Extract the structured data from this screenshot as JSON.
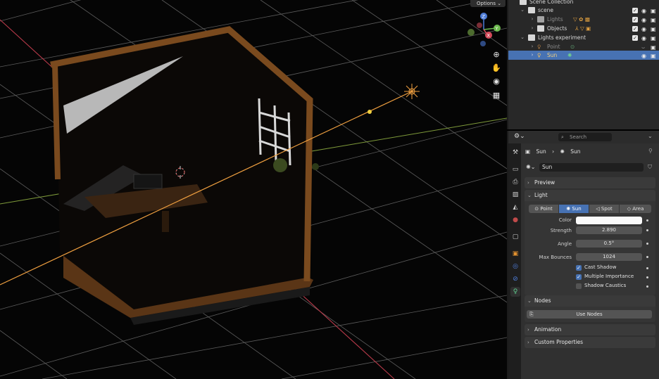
{
  "viewport": {
    "options_label": "Options",
    "gizmo": {
      "z": "Z",
      "y": "Y",
      "x": "X"
    },
    "tools": [
      "zoom-icon",
      "hand-icon",
      "camera-icon",
      "grid-icon"
    ]
  },
  "outliner": {
    "rows": [
      {
        "label": "Scene Collection"
      },
      {
        "label": "scene"
      },
      {
        "label": "Lights"
      },
      {
        "label": "Objects"
      },
      {
        "label": "Lights experiment"
      },
      {
        "label": "Point"
      },
      {
        "label": "Sun"
      }
    ]
  },
  "properties": {
    "search_placeholder": "Search",
    "breadcrumb": {
      "object": "Sun",
      "data": "Sun"
    },
    "data_name": "Sun",
    "panels": {
      "preview": "Preview",
      "light": "Light",
      "nodes": "Nodes",
      "animation": "Animation",
      "custom": "Custom Properties"
    },
    "light_types": [
      "Point",
      "Sun",
      "Spot",
      "Area"
    ],
    "active_light_type": "Sun",
    "fields": {
      "color_label": "Color",
      "color_value": "#fafafa",
      "strength_label": "Strength",
      "strength_value": "2.890",
      "angle_label": "Angle",
      "angle_value": "0.5°",
      "bounces_label": "Max Bounces",
      "bounces_value": "1024"
    },
    "checkboxes": [
      {
        "label": "Cast Shadow",
        "checked": true
      },
      {
        "label": "Multiple Importance",
        "checked": true
      },
      {
        "label": "Shadow Caustics",
        "checked": false
      }
    ],
    "use_nodes_label": "Use Nodes"
  },
  "colors": {
    "accent": "#4772b3",
    "panel": "#303030",
    "outliner": "#282828",
    "sun_ray": "#f0a040"
  }
}
